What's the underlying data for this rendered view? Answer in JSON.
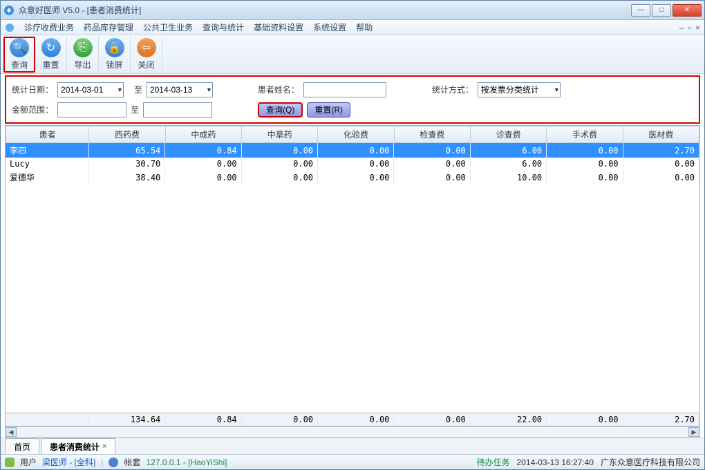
{
  "window": {
    "title": "众意好医师 V5.0 - [患者消费统计]"
  },
  "menu": {
    "items": [
      "诊疗收费业务",
      "药品库存管理",
      "公共卫生业务",
      "查询与统计",
      "基础资料设置",
      "系统设置",
      "帮助"
    ]
  },
  "toolbar": {
    "query": "查询",
    "reset": "重置",
    "export": "导出",
    "lock": "锁屏",
    "close": "关闭"
  },
  "filters": {
    "date_label": "统计日期：",
    "date_from": "2014-03-01",
    "date_to_label": "至",
    "date_to": "2014-03-13",
    "name_label": "患者姓名：",
    "name_value": "",
    "method_label": "统计方式：",
    "method_value": "按发票分类统计",
    "amount_label": "金额范围：",
    "amount_from": "",
    "amount_to_label": "至",
    "amount_to": "",
    "btn_query": "查询(Q)",
    "btn_reset": "重置(R)"
  },
  "table": {
    "headers": [
      "患者",
      "西药费",
      "中成药",
      "中草药",
      "化验费",
      "检查费",
      "诊查费",
      "手术费",
      "医材费"
    ],
    "rows": [
      {
        "name": "李四",
        "c1": "65.54",
        "c2": "0.84",
        "c3": "0.00",
        "c4": "0.00",
        "c5": "0.00",
        "c6": "6.00",
        "c7": "0.00",
        "c8": "2.70",
        "selected": true
      },
      {
        "name": "Lucy",
        "c1": "30.70",
        "c2": "0.00",
        "c3": "0.00",
        "c4": "0.00",
        "c5": "0.00",
        "c6": "6.00",
        "c7": "0.00",
        "c8": "0.00"
      },
      {
        "name": "爱德华",
        "c1": "38.40",
        "c2": "0.00",
        "c3": "0.00",
        "c4": "0.00",
        "c5": "0.00",
        "c6": "10.00",
        "c7": "0.00",
        "c8": "0.00"
      }
    ],
    "totals": {
      "c1": "134.64",
      "c2": "0.84",
      "c3": "0.00",
      "c4": "0.00",
      "c5": "0.00",
      "c6": "22.00",
      "c7": "0.00",
      "c8": "2.70"
    }
  },
  "tabs": {
    "home": "首页",
    "current": "患者消费统计"
  },
  "status": {
    "user_label": "用户",
    "user_value": "梁医师 - [全科]",
    "acct_label": "帐套",
    "acct_value": "127.0.0.1 - [HaoYiShi]",
    "todo": "待办任务",
    "time": "2014-03-13 16:27:40",
    "company": "广东众意医疗科技有限公司"
  }
}
